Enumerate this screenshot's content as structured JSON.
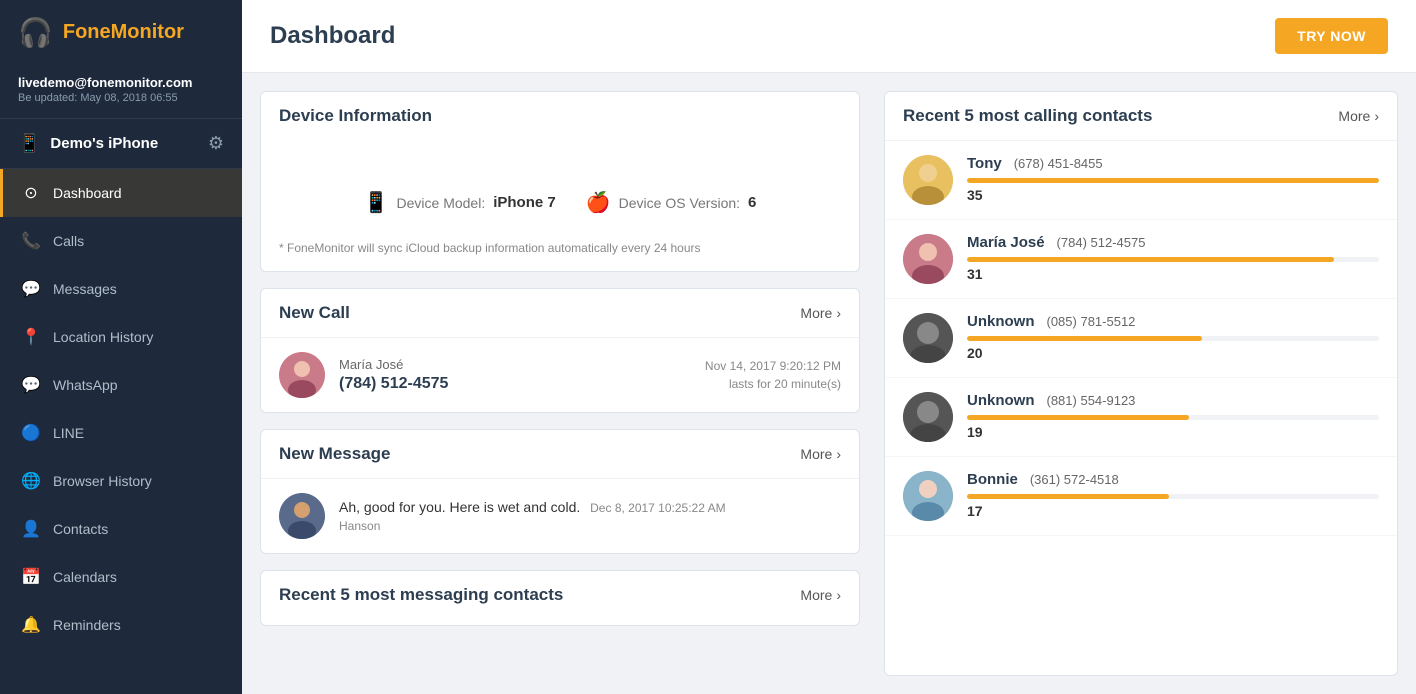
{
  "brand": {
    "logo_icon": "🎧",
    "logo_text": "FoneMonitor"
  },
  "user": {
    "email": "livedemo@fonemonitor.com",
    "updated": "Be updated: May 08, 2018 06:55"
  },
  "device": {
    "name": "Demo's iPhone",
    "model_label": "Device Model:",
    "model_value": "iPhone 7",
    "os_label": "Device OS Version:",
    "os_value": "6",
    "note": "* FoneMonitor will sync iCloud backup information automatically every 24 hours"
  },
  "header": {
    "title": "Dashboard",
    "try_now": "TRY NOW"
  },
  "sidebar": {
    "items": [
      {
        "label": "Dashboard",
        "icon": "⊙",
        "active": true
      },
      {
        "label": "Calls",
        "icon": "📞"
      },
      {
        "label": "Messages",
        "icon": "💬"
      },
      {
        "label": "Location History",
        "icon": "📍"
      },
      {
        "label": "WhatsApp",
        "icon": "💚"
      },
      {
        "label": "LINE",
        "icon": "💬"
      },
      {
        "label": "Browser History",
        "icon": "🌐"
      },
      {
        "label": "Contacts",
        "icon": "👤"
      },
      {
        "label": "Calendars",
        "icon": "📅"
      },
      {
        "label": "Reminders",
        "icon": "🔔"
      }
    ]
  },
  "device_info_card": {
    "title": "Device Information"
  },
  "new_call": {
    "title": "New Call",
    "more": "More",
    "contact_name": "María José",
    "phone": "(784) 512-4575",
    "date": "Nov 14, 2017 9:20:12 PM",
    "duration": "lasts for 20 minute(s)"
  },
  "new_message": {
    "title": "New Message",
    "more": "More",
    "text": "Ah, good for you. Here is wet and cold.",
    "date": "Dec 8, 2017 10:25:22 AM",
    "sender": "Hanson"
  },
  "recent_messaging": {
    "title": "Recent 5 most messaging contacts",
    "more": "More"
  },
  "recent_calling": {
    "title": "Recent 5 most calling contacts",
    "more": "More",
    "contacts": [
      {
        "name": "Tony",
        "phone": "(678) 451-8455",
        "count": 35,
        "bar_pct": 100
      },
      {
        "name": "María José",
        "phone": "(784) 512-4575",
        "count": 31,
        "bar_pct": 89
      },
      {
        "name": "Unknown",
        "phone": "(085) 781-5512",
        "count": 20,
        "bar_pct": 57
      },
      {
        "name": "Unknown",
        "phone": "(881) 554-9123",
        "count": 19,
        "bar_pct": 54
      },
      {
        "name": "Bonnie",
        "phone": "(361) 572-4518",
        "count": 17,
        "bar_pct": 49
      }
    ]
  }
}
